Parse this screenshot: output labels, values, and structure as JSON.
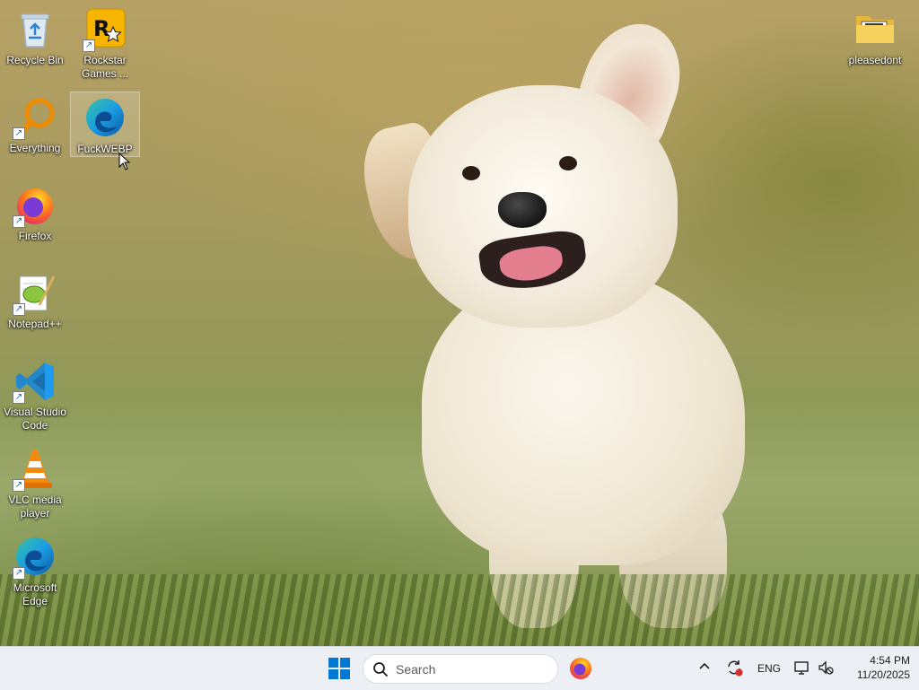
{
  "desktop": {
    "icons": [
      {
        "label": "Recycle Bin",
        "icon": "recycle-bin-icon",
        "shortcut": false
      },
      {
        "label": "Rockstar Games ...",
        "icon": "rockstar-games-icon",
        "shortcut": true
      },
      {
        "label": "Everything",
        "icon": "everything-search-icon",
        "shortcut": true
      },
      {
        "label": "FuckWEBP",
        "icon": "edge-icon",
        "shortcut": false,
        "selected": true
      },
      {
        "label": "Firefox",
        "icon": "firefox-icon",
        "shortcut": true
      },
      {
        "label": "Notepad++",
        "icon": "notepad-plus-plus-icon",
        "shortcut": true
      },
      {
        "label": "Visual Studio Code",
        "icon": "vscode-icon",
        "shortcut": true
      },
      {
        "label": "VLC media player",
        "icon": "vlc-icon",
        "shortcut": true
      },
      {
        "label": "Microsoft Edge",
        "icon": "edge-icon",
        "shortcut": true
      },
      {
        "label": "pleasedont",
        "icon": "folder-icon",
        "shortcut": false
      }
    ]
  },
  "taskbar": {
    "start_icon": "windows-start-icon",
    "search_placeholder": "Search",
    "pinned_apps": [
      {
        "name": "Firefox",
        "icon": "firefox-icon"
      }
    ],
    "tray": {
      "overflow_icon": "chevron-up-icon",
      "update_icon": "sync-alert-icon",
      "language": "ENG",
      "network_icon": "network-icon",
      "volume_icon": "volume-muted-icon"
    },
    "clock": {
      "time": "4:54 PM",
      "date": "11/20/2025"
    }
  },
  "colors": {
    "taskbar_bg": "#ecf0f4",
    "windows_blue": "#0078d4",
    "desktop_label": "#ffffff"
  }
}
